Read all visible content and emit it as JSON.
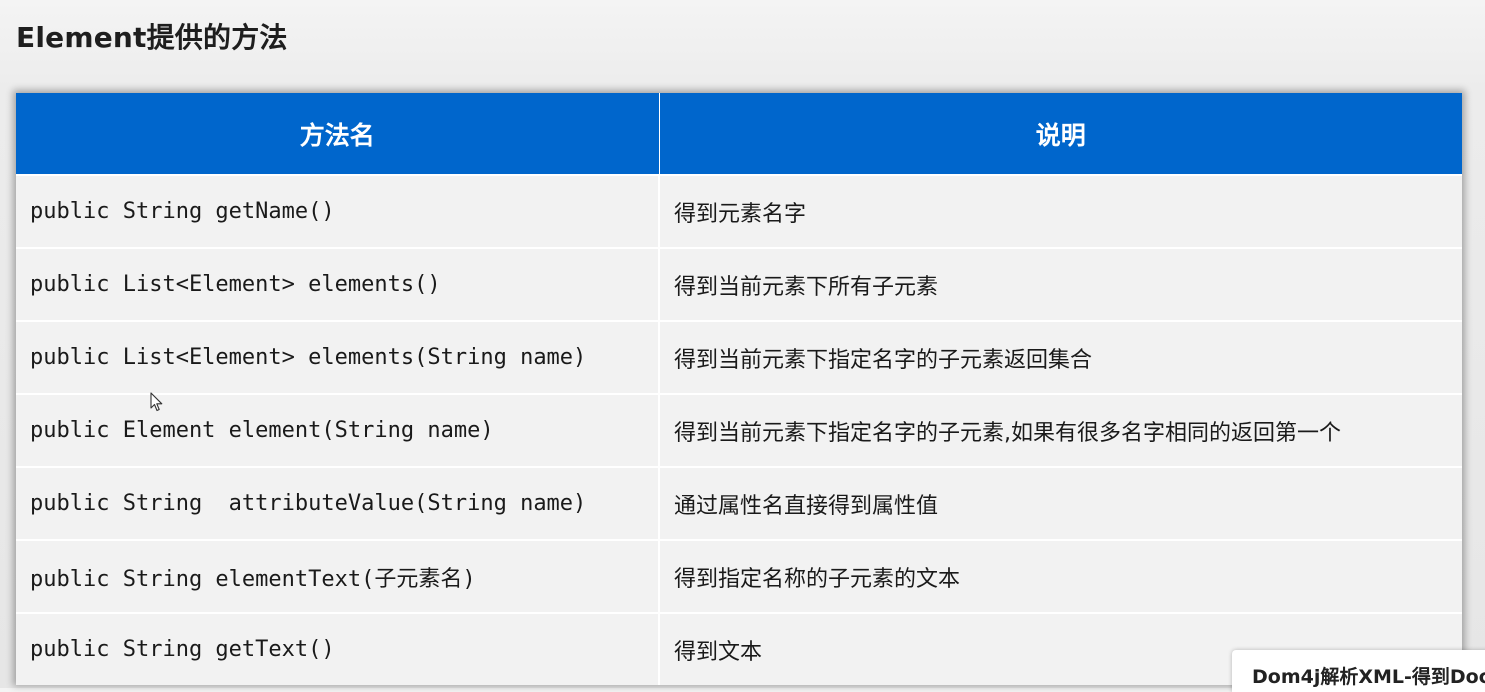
{
  "page": {
    "title": "Element提供的方法"
  },
  "table": {
    "headers": [
      "方法名",
      "说明"
    ],
    "rows": [
      {
        "method": "public String getName()",
        "description": "得到元素名字"
      },
      {
        "method": "public List<Element> elements()",
        "description": "得到当前元素下所有子元素"
      },
      {
        "method": "public List<Element> elements(String name)",
        "description": "得到当前元素下指定名字的子元素返回集合"
      },
      {
        "method": "public Element element(String name)",
        "description": "得到当前元素下指定名字的子元素,如果有很多名字相同的返回第一个"
      },
      {
        "method": "public String  attributeValue(String name)",
        "description": "通过属性名直接得到属性值"
      },
      {
        "method": "public String elementText(子元素名)",
        "description": "得到指定名称的子元素的文本"
      },
      {
        "method": "public String getText()",
        "description": "得到文本"
      }
    ]
  },
  "caption": {
    "text": "Dom4j解析XML-得到Doc"
  },
  "colors": {
    "header_bg": "#0066cc",
    "header_text": "#ffffff",
    "row_bg": "#f2f2f2"
  },
  "icons": {
    "cursor": "mouse-pointer-icon"
  }
}
